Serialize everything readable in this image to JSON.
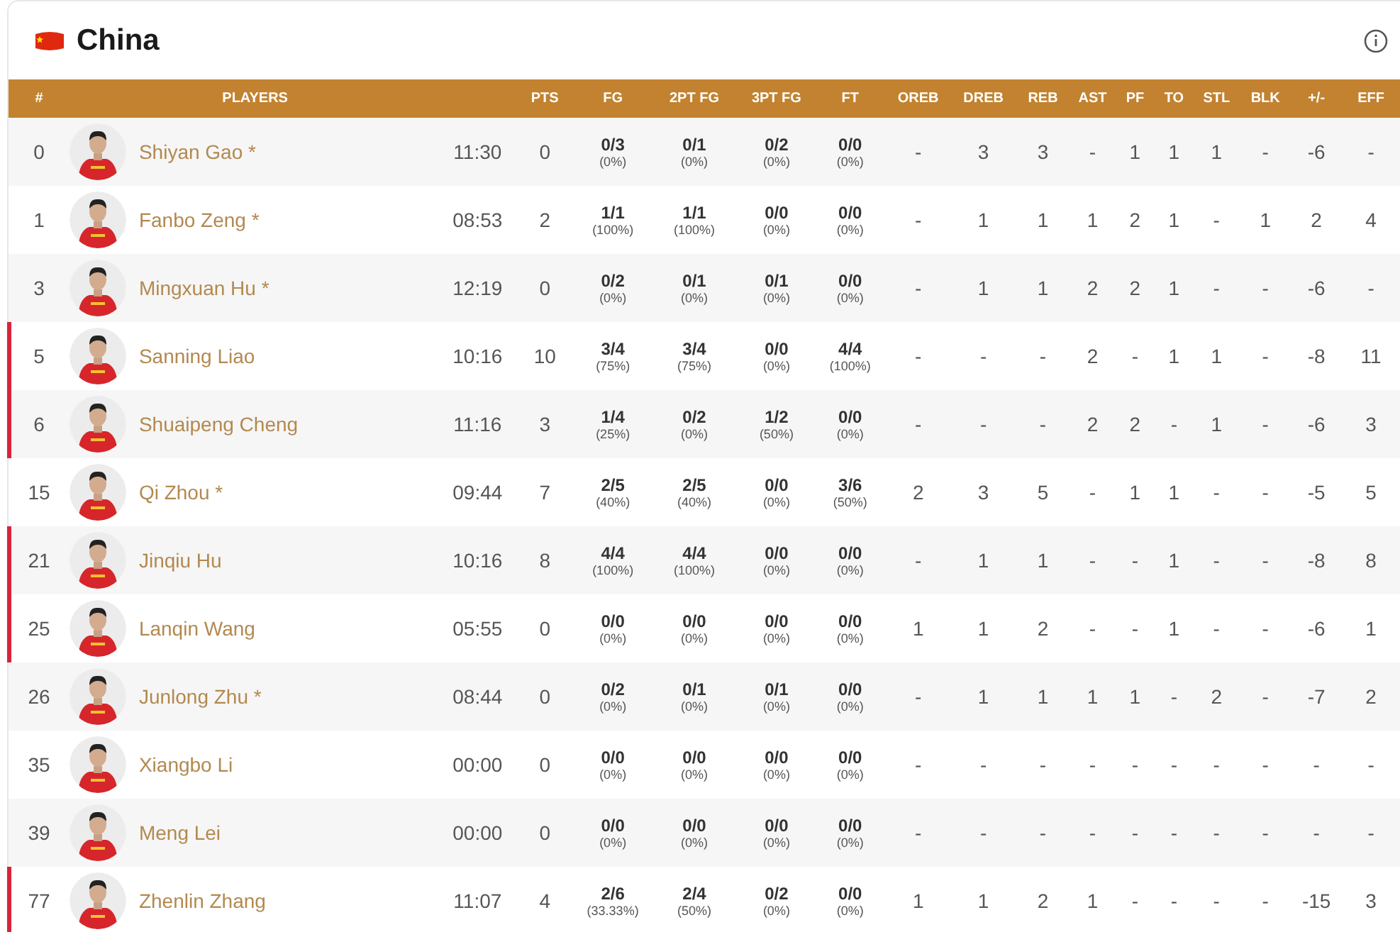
{
  "team": {
    "name": "China"
  },
  "header": {
    "number": "#",
    "players": "PLAYERS",
    "points": "PTS",
    "shooting": [
      "FG",
      "2PT FG",
      "3PT FG",
      "FT"
    ],
    "counts": [
      "OREB",
      "DREB",
      "REB",
      "AST",
      "PF",
      "TO",
      "STL",
      "BLK",
      "+/-",
      "EFF"
    ]
  },
  "rows": [
    {
      "number": "0",
      "name": "Shiyan Gao *",
      "minutes": "11:30",
      "points": "0",
      "on_court": false,
      "shooting": [
        {
          "made": "0/3",
          "pct": "(0%)"
        },
        {
          "made": "0/1",
          "pct": "(0%)"
        },
        {
          "made": "0/2",
          "pct": "(0%)"
        },
        {
          "made": "0/0",
          "pct": "(0%)"
        }
      ],
      "counts": [
        "-",
        "3",
        "3",
        "-",
        "1",
        "1",
        "1",
        "-",
        "-6",
        "-"
      ]
    },
    {
      "number": "1",
      "name": "Fanbo Zeng *",
      "minutes": "08:53",
      "points": "2",
      "on_court": false,
      "shooting": [
        {
          "made": "1/1",
          "pct": "(100%)"
        },
        {
          "made": "1/1",
          "pct": "(100%)"
        },
        {
          "made": "0/0",
          "pct": "(0%)"
        },
        {
          "made": "0/0",
          "pct": "(0%)"
        }
      ],
      "counts": [
        "-",
        "1",
        "1",
        "1",
        "2",
        "1",
        "-",
        "1",
        "2",
        "4"
      ]
    },
    {
      "number": "3",
      "name": "Mingxuan Hu *",
      "minutes": "12:19",
      "points": "0",
      "on_court": false,
      "shooting": [
        {
          "made": "0/2",
          "pct": "(0%)"
        },
        {
          "made": "0/1",
          "pct": "(0%)"
        },
        {
          "made": "0/1",
          "pct": "(0%)"
        },
        {
          "made": "0/0",
          "pct": "(0%)"
        }
      ],
      "counts": [
        "-",
        "1",
        "1",
        "2",
        "2",
        "1",
        "-",
        "-",
        "-6",
        "-"
      ]
    },
    {
      "number": "5",
      "name": "Sanning Liao",
      "minutes": "10:16",
      "points": "10",
      "on_court": true,
      "shooting": [
        {
          "made": "3/4",
          "pct": "(75%)"
        },
        {
          "made": "3/4",
          "pct": "(75%)"
        },
        {
          "made": "0/0",
          "pct": "(0%)"
        },
        {
          "made": "4/4",
          "pct": "(100%)"
        }
      ],
      "counts": [
        "-",
        "-",
        "-",
        "2",
        "-",
        "1",
        "1",
        "-",
        "-8",
        "11"
      ]
    },
    {
      "number": "6",
      "name": "Shuaipeng Cheng",
      "minutes": "11:16",
      "points": "3",
      "on_court": true,
      "shooting": [
        {
          "made": "1/4",
          "pct": "(25%)"
        },
        {
          "made": "0/2",
          "pct": "(0%)"
        },
        {
          "made": "1/2",
          "pct": "(50%)"
        },
        {
          "made": "0/0",
          "pct": "(0%)"
        }
      ],
      "counts": [
        "-",
        "-",
        "-",
        "2",
        "2",
        "-",
        "1",
        "-",
        "-6",
        "3"
      ]
    },
    {
      "number": "15",
      "name": "Qi Zhou *",
      "minutes": "09:44",
      "points": "7",
      "on_court": false,
      "shooting": [
        {
          "made": "2/5",
          "pct": "(40%)"
        },
        {
          "made": "2/5",
          "pct": "(40%)"
        },
        {
          "made": "0/0",
          "pct": "(0%)"
        },
        {
          "made": "3/6",
          "pct": "(50%)"
        }
      ],
      "counts": [
        "2",
        "3",
        "5",
        "-",
        "1",
        "1",
        "-",
        "-",
        "-5",
        "5"
      ]
    },
    {
      "number": "21",
      "name": "Jinqiu Hu",
      "minutes": "10:16",
      "points": "8",
      "on_court": true,
      "shooting": [
        {
          "made": "4/4",
          "pct": "(100%)"
        },
        {
          "made": "4/4",
          "pct": "(100%)"
        },
        {
          "made": "0/0",
          "pct": "(0%)"
        },
        {
          "made": "0/0",
          "pct": "(0%)"
        }
      ],
      "counts": [
        "-",
        "1",
        "1",
        "-",
        "-",
        "1",
        "-",
        "-",
        "-8",
        "8"
      ]
    },
    {
      "number": "25",
      "name": "Lanqin Wang",
      "minutes": "05:55",
      "points": "0",
      "on_court": true,
      "shooting": [
        {
          "made": "0/0",
          "pct": "(0%)"
        },
        {
          "made": "0/0",
          "pct": "(0%)"
        },
        {
          "made": "0/0",
          "pct": "(0%)"
        },
        {
          "made": "0/0",
          "pct": "(0%)"
        }
      ],
      "counts": [
        "1",
        "1",
        "2",
        "-",
        "-",
        "1",
        "-",
        "-",
        "-6",
        "1"
      ]
    },
    {
      "number": "26",
      "name": "Junlong Zhu *",
      "minutes": "08:44",
      "points": "0",
      "on_court": false,
      "shooting": [
        {
          "made": "0/2",
          "pct": "(0%)"
        },
        {
          "made": "0/1",
          "pct": "(0%)"
        },
        {
          "made": "0/1",
          "pct": "(0%)"
        },
        {
          "made": "0/0",
          "pct": "(0%)"
        }
      ],
      "counts": [
        "-",
        "1",
        "1",
        "1",
        "1",
        "-",
        "2",
        "-",
        "-7",
        "2"
      ]
    },
    {
      "number": "35",
      "name": "Xiangbo Li",
      "minutes": "00:00",
      "points": "0",
      "on_court": false,
      "shooting": [
        {
          "made": "0/0",
          "pct": "(0%)"
        },
        {
          "made": "0/0",
          "pct": "(0%)"
        },
        {
          "made": "0/0",
          "pct": "(0%)"
        },
        {
          "made": "0/0",
          "pct": "(0%)"
        }
      ],
      "counts": [
        "-",
        "-",
        "-",
        "-",
        "-",
        "-",
        "-",
        "-",
        "-",
        "-"
      ]
    },
    {
      "number": "39",
      "name": "Meng Lei",
      "minutes": "00:00",
      "points": "0",
      "on_court": false,
      "shooting": [
        {
          "made": "0/0",
          "pct": "(0%)"
        },
        {
          "made": "0/0",
          "pct": "(0%)"
        },
        {
          "made": "0/0",
          "pct": "(0%)"
        },
        {
          "made": "0/0",
          "pct": "(0%)"
        }
      ],
      "counts": [
        "-",
        "-",
        "-",
        "-",
        "-",
        "-",
        "-",
        "-",
        "-",
        "-"
      ]
    },
    {
      "number": "77",
      "name": "Zhenlin Zhang",
      "minutes": "11:07",
      "points": "4",
      "on_court": true,
      "shooting": [
        {
          "made": "2/6",
          "pct": "(33.33%)"
        },
        {
          "made": "2/4",
          "pct": "(50%)"
        },
        {
          "made": "0/2",
          "pct": "(0%)"
        },
        {
          "made": "0/0",
          "pct": "(0%)"
        }
      ],
      "counts": [
        "1",
        "1",
        "2",
        "1",
        "-",
        "-",
        "-",
        "-",
        "-15",
        "3"
      ]
    }
  ]
}
